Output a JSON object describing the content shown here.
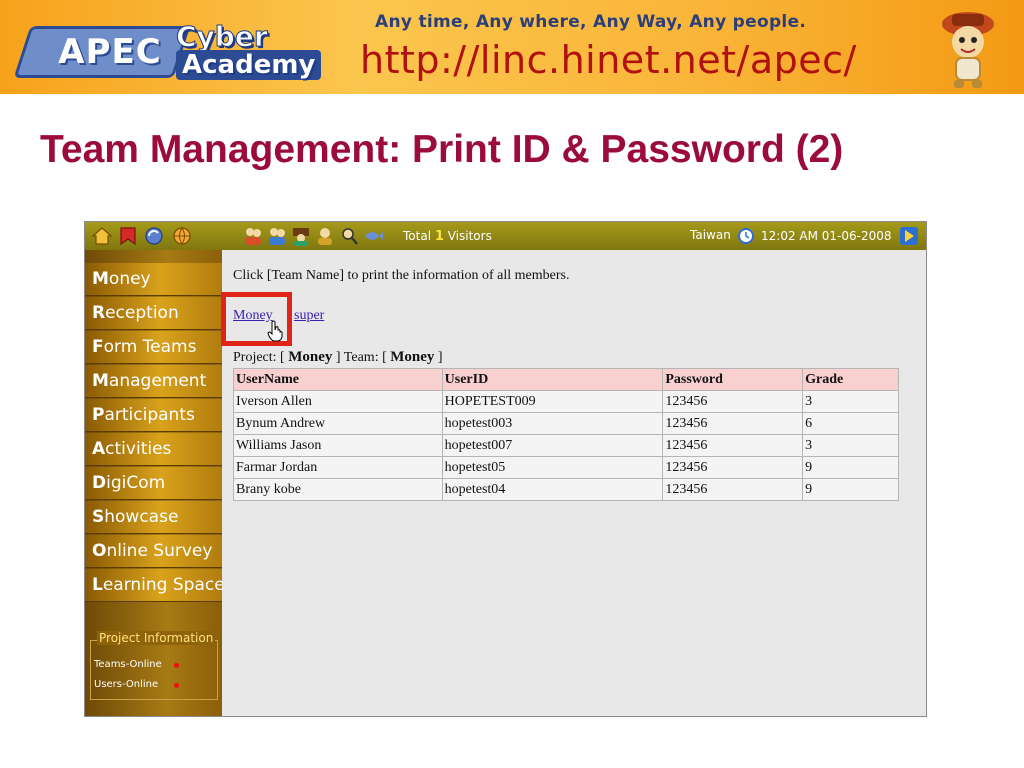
{
  "banner": {
    "logo_apec": "APEC",
    "logo_cyber": "Cyber",
    "logo_academy": "Academy",
    "tagline": "Any time, Any where, Any Way, Any people.",
    "url": "http://linc.hinet.net/apec/",
    "mascot_icon": "mascot-icon"
  },
  "slide": {
    "title": "Team Management: Print ID & Password (2)"
  },
  "topbar": {
    "nav_icons": [
      "home-icon",
      "bookmark-icon",
      "refresh-icon",
      "globe-icon"
    ],
    "people_icons": [
      "people-icon",
      "user-group-icon",
      "class-icon",
      "teacher-icon",
      "search-user-icon",
      "fish-icon"
    ],
    "visitor_prefix": "Total",
    "visitor_count": "1",
    "visitor_suffix": "Visitors",
    "region": "Taiwan",
    "clock": "12:02 AM 01-06-2008"
  },
  "sidebar": {
    "items": [
      {
        "initial": "M",
        "rest": "oney"
      },
      {
        "initial": "R",
        "rest": "eception"
      },
      {
        "initial": "F",
        "rest": "orm Teams"
      },
      {
        "initial": "M",
        "rest": "anagement"
      },
      {
        "initial": "P",
        "rest": "articipants"
      },
      {
        "initial": "A",
        "rest": "ctivities"
      },
      {
        "initial": "D",
        "rest": "igiCom"
      },
      {
        "initial": "S",
        "rest": "howcase"
      },
      {
        "initial": "O",
        "rest": "nline Survey"
      },
      {
        "initial": "L",
        "rest": "earning Space"
      }
    ],
    "project_info": {
      "legend": "Project Information",
      "teams_online": "Teams-Online",
      "users_online": "Users-Online"
    }
  },
  "content": {
    "instruction": "Click [Team Name] to print the information of all members.",
    "team_links": [
      "Money",
      "super"
    ],
    "project_label": "Project: [",
    "project_name": "Money",
    "team_label": "] Team: [",
    "team_name": "Money",
    "team_close": "]",
    "table": {
      "headers": [
        "UserName",
        "UserID",
        "Password",
        "Grade"
      ],
      "rows": [
        [
          "Iverson Allen",
          "HOPETEST009",
          "123456",
          "3"
        ],
        [
          "Bynum Andrew",
          "hopetest003",
          "123456",
          "6"
        ],
        [
          "Williams Jason",
          "hopetest007",
          "123456",
          "3"
        ],
        [
          "Farmar Jordan",
          "hopetest05",
          "123456",
          "9"
        ],
        [
          "Brany kobe",
          "hopetest04",
          "123456",
          "9"
        ]
      ]
    }
  }
}
